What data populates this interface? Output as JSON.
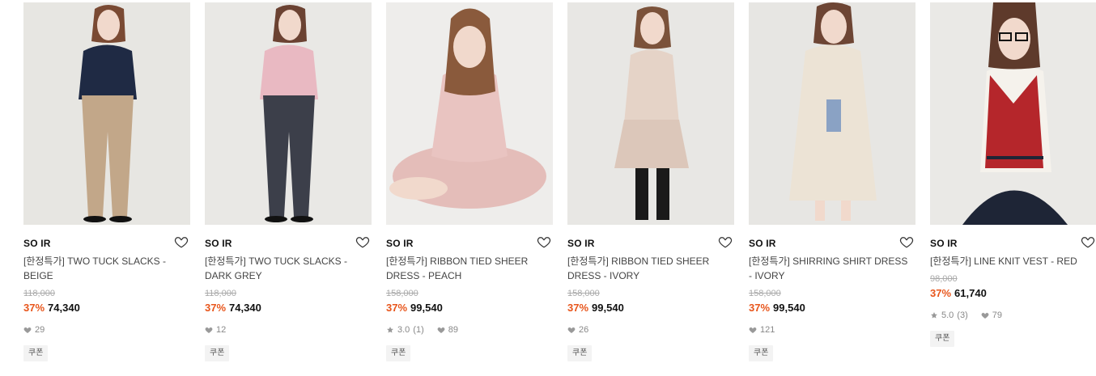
{
  "products": [
    {
      "brand": "SO IR",
      "title": "[한정특가] TWO TUCK SLACKS - BEIGE",
      "original_price": "118,000",
      "discount": "37%",
      "price": "74,340",
      "rating": "",
      "review_count": "",
      "likes": "29",
      "coupon": "쿠폰",
      "photo": {
        "bg": "#e7e6e2",
        "top": "#1f2a44",
        "bottom": "#c2a789",
        "hair": "#7a4a33",
        "pose": "standing"
      }
    },
    {
      "brand": "SO IR",
      "title": "[한정특가] TWO TUCK SLACKS - DARK GREY",
      "original_price": "118,000",
      "discount": "37%",
      "price": "74,340",
      "rating": "",
      "review_count": "",
      "likes": "12",
      "coupon": "쿠폰",
      "photo": {
        "bg": "#e9e8e5",
        "top": "#e9b9c2",
        "bottom": "#3c3f4a",
        "hair": "#6b4232",
        "pose": "leaning"
      }
    },
    {
      "brand": "SO IR",
      "title": "[한정특가] RIBBON TIED SHEER DRESS - PEACH",
      "original_price": "158,000",
      "discount": "37%",
      "price": "99,540",
      "rating": "3.0",
      "review_count": "(1)",
      "likes": "89",
      "coupon": "쿠폰",
      "photo": {
        "bg": "#eeedeb",
        "top": "#e9c4c1",
        "bottom": "#e4bdb9",
        "hair": "#8a5a3c",
        "pose": "sitting"
      }
    },
    {
      "brand": "SO IR",
      "title": "[한정특가] RIBBON TIED SHEER DRESS - IVORY",
      "original_price": "158,000",
      "discount": "37%",
      "price": "99,540",
      "rating": "",
      "review_count": "",
      "likes": "26",
      "coupon": "쿠폰",
      "photo": {
        "bg": "#e8e7e4",
        "top": "#e5d3c7",
        "bottom": "#dcc7ba",
        "hair": "#7b523a",
        "pose": "standing-dress"
      }
    },
    {
      "brand": "SO IR",
      "title": "[한정특가] SHIRRING SHIRT DRESS - IVORY",
      "original_price": "158,000",
      "discount": "37%",
      "price": "99,540",
      "rating": "",
      "review_count": "",
      "likes": "121",
      "coupon": "쿠폰",
      "photo": {
        "bg": "#e7e6e3",
        "top": "#ece3d5",
        "bottom": "#e6dccc",
        "hair": "#6d4534",
        "pose": "coat"
      }
    },
    {
      "brand": "SO IR",
      "title": "[한정특가] LINE KNIT VEST - RED",
      "original_price": "98,000",
      "discount": "37%",
      "price": "61,740",
      "rating": "5.0",
      "review_count": "(3)",
      "likes": "79",
      "coupon": "쿠폰",
      "photo": {
        "bg": "#eae9e6",
        "top": "#b5262b",
        "bottom": "#1e2536",
        "hair": "#5e3a2b",
        "pose": "vest"
      }
    }
  ],
  "colors": {
    "discount": "#e8561c",
    "strike": "#aaaaaa",
    "coupon_bg": "#f3f3f3"
  }
}
